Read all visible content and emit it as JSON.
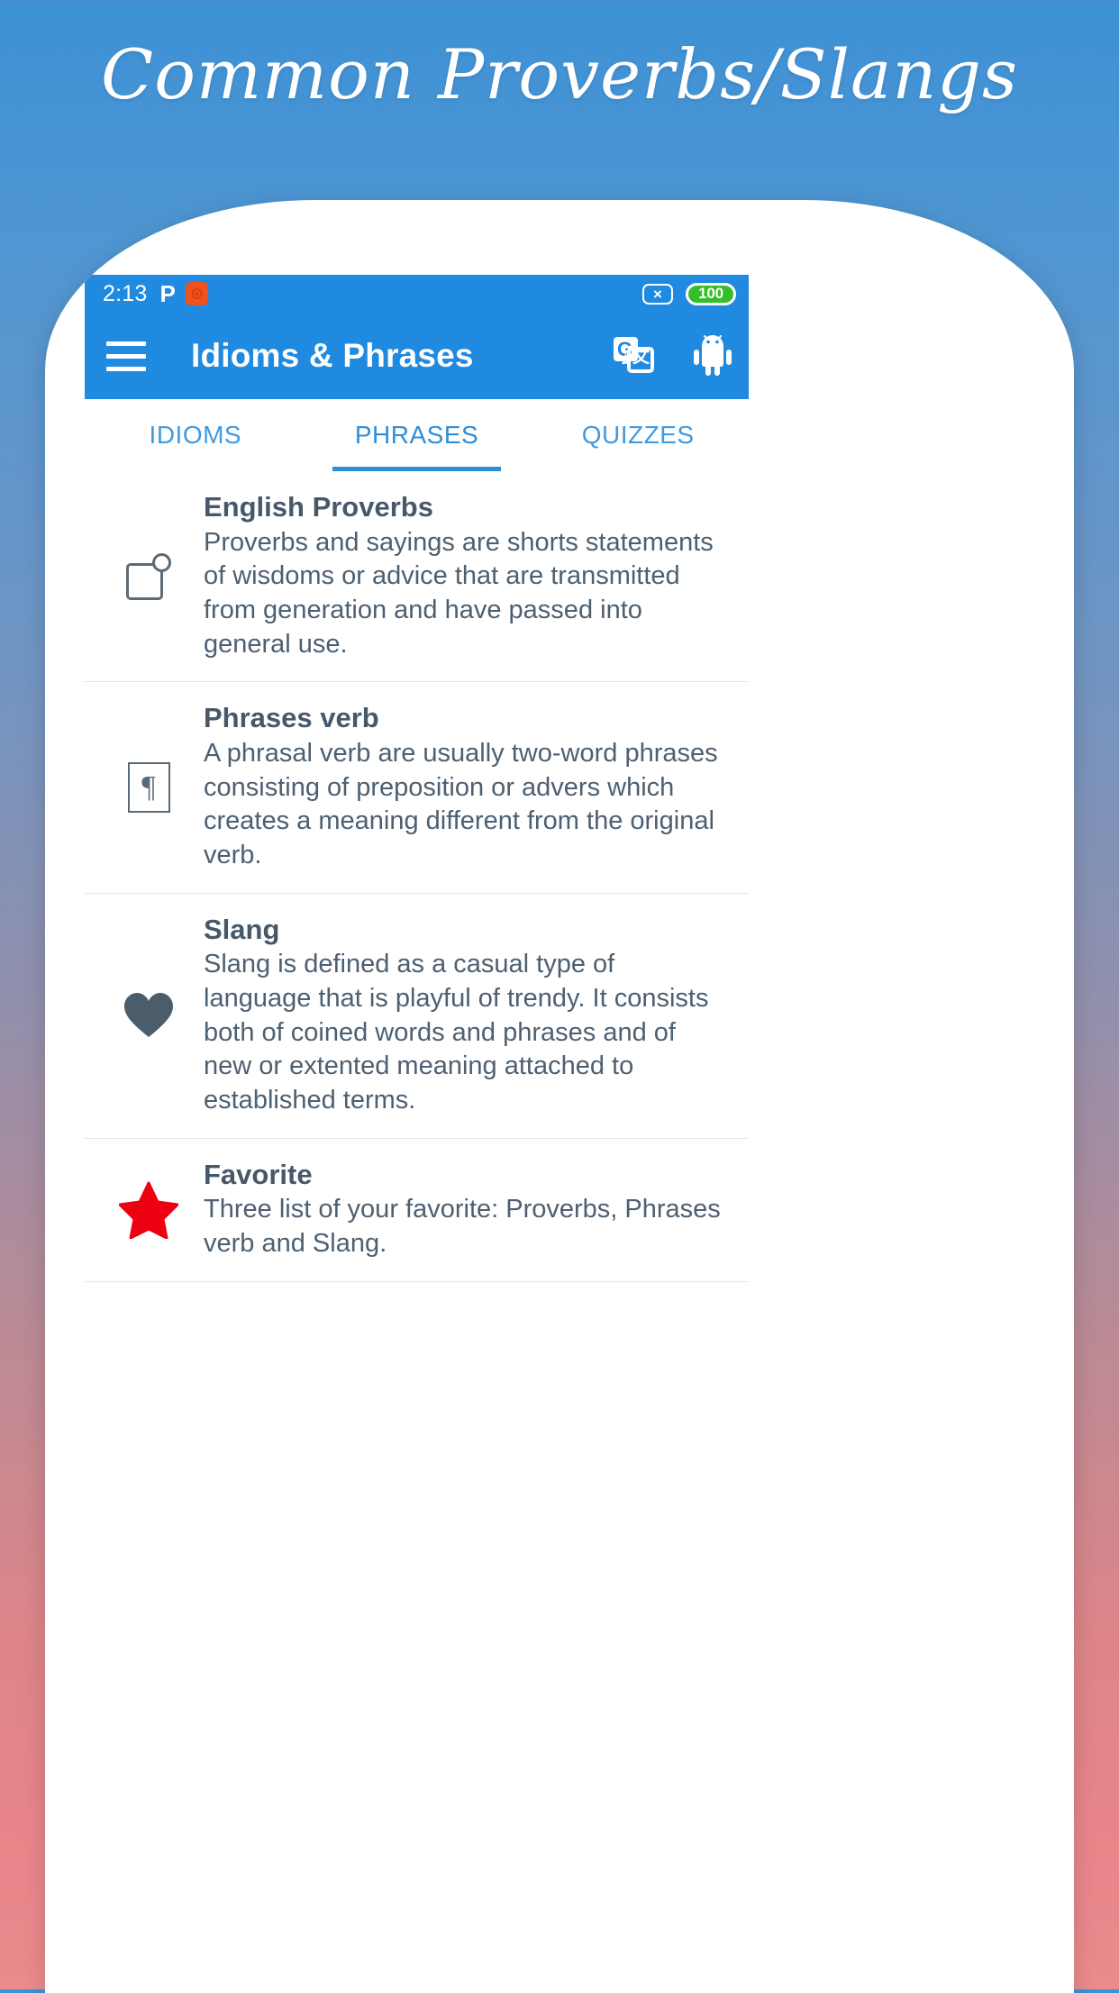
{
  "page": {
    "title": "Common Proverbs/Slangs",
    "background_top_color": "#3d91d6",
    "background_bottom_color": "#ea8b8d"
  },
  "statusbar": {
    "time": "2:13",
    "left_icons": [
      {
        "name": "pushbullet-icon",
        "glyph": "P"
      },
      {
        "name": "orange-app-icon",
        "glyph": ""
      }
    ],
    "no_sim_glyph": "×",
    "battery_level": "100",
    "battery_color": "#35bd2a",
    "bar_color": "#2089e0"
  },
  "appbar": {
    "menu_icon": "hamburger-icon",
    "title": "Idioms & Phrases",
    "actions": [
      {
        "name": "google-translate-icon",
        "g_letter": "G",
        "cjk_letter": "文"
      },
      {
        "name": "android-robot-icon"
      }
    ],
    "color": "#2089e0"
  },
  "tabs": {
    "accent_color": "#2f8ed8",
    "items": [
      {
        "label": "IDIOMS",
        "active": false
      },
      {
        "label": "PHRASES",
        "active": true
      },
      {
        "label": "QUIZZES",
        "active": false
      }
    ]
  },
  "list": {
    "items": [
      {
        "icon": "note-square-icon",
        "title": "English Proverbs",
        "description": "Proverbs and sayings are shorts statements of wisdoms or advice that are transmitted from generation and have passed into general use."
      },
      {
        "icon": "pilcrow-icon",
        "title": "Phrases verb",
        "description": "A phrasal verb are usually two-word phrases consisting of preposition or advers which creates a meaning different from the original verb."
      },
      {
        "icon": "heart-icon",
        "title": "Slang",
        "description": "Slang is defined as a casual type of language that is playful of trendy. It consists both of coined words and phrases and of new or extented meaning attached to established terms."
      },
      {
        "icon": "star-icon",
        "title": "Favorite",
        "description": "Three list of your favorite: Proverbs, Phrases verb and Slang.",
        "icon_color": "#ee0013"
      }
    ]
  }
}
